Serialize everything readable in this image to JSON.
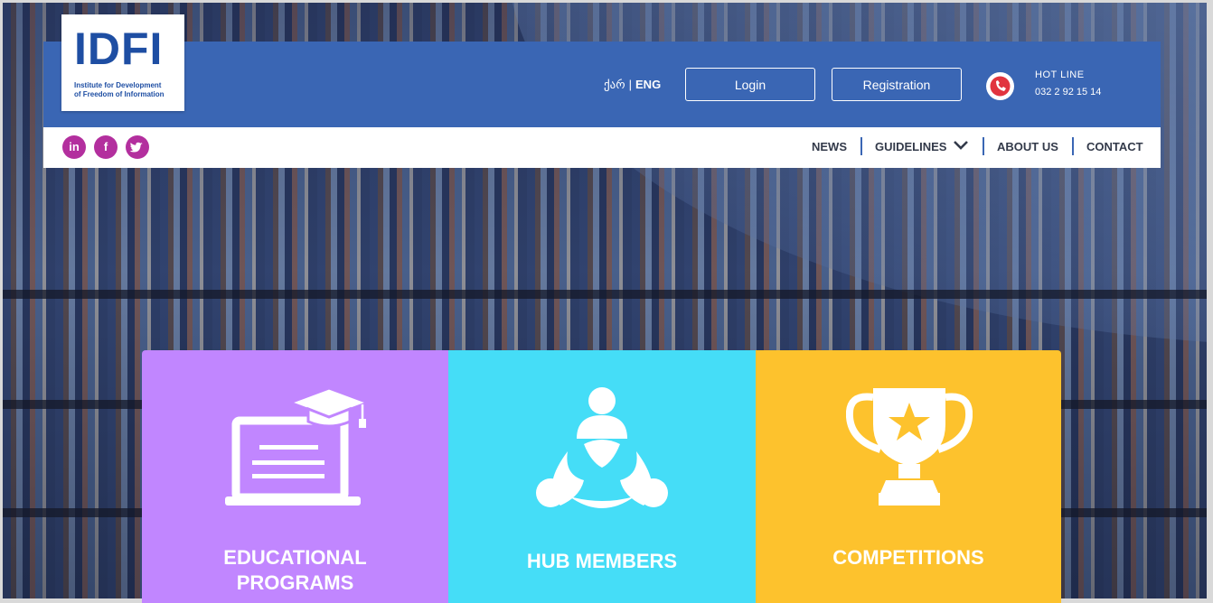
{
  "header": {
    "logo": {
      "mark": "IDFI",
      "subtitle_line1": "Institute for Development",
      "subtitle_line2": "of Freedom of Information"
    },
    "language": {
      "georgian": "ქარ",
      "separator": "|",
      "english": "ENG"
    },
    "login_label": "Login",
    "registration_label": "Registration",
    "hotline": {
      "title": "HOT LINE",
      "number": "032 2 92 15 14"
    }
  },
  "social": {
    "linkedin": "in",
    "facebook": "f",
    "twitter": "t"
  },
  "nav": {
    "news": "NEWS",
    "guidelines": "GUIDELINES",
    "about": "ABOUT US",
    "contact": "CONTACT"
  },
  "tiles": [
    {
      "line1": "EDUCATIONAL",
      "line2": "PROGRAMS",
      "icon": "laptop-graduation-cap-icon",
      "color": "#c186ff"
    },
    {
      "line1": "HUB MEMBERS",
      "icon": "community-icon",
      "color": "#45ddf7"
    },
    {
      "line1": "COMPETITIONS",
      "icon": "trophy-icon",
      "color": "#fdc22d"
    }
  ],
  "colors": {
    "header_blue": "#3a66b4",
    "social_purple": "#b32f9e",
    "phone_red": "#e1343f"
  }
}
